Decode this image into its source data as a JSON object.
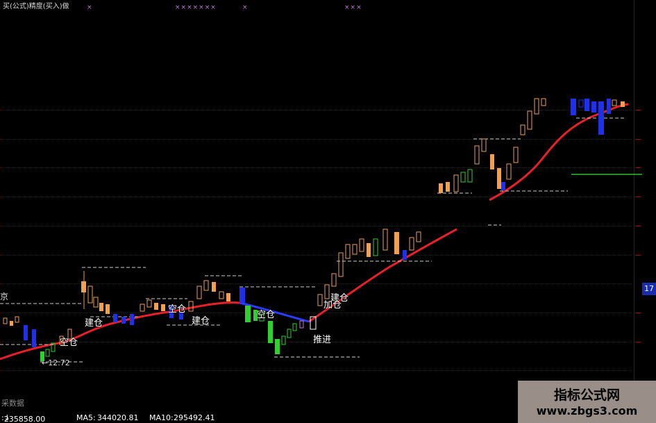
{
  "header": {
    "title": "买(公式)精度(买入)做",
    "x_marks": [
      "×",
      "×××××××",
      "×",
      "×××"
    ]
  },
  "annotations": [
    {
      "id": "jiancang-1",
      "text": "建仓"
    },
    {
      "id": "kongcang-1",
      "text": "空仓"
    },
    {
      "id": "kongcang-2",
      "text": "空仓"
    },
    {
      "id": "jiancang-2",
      "text": "建仓"
    },
    {
      "id": "kongcang-3",
      "text": "空仓"
    },
    {
      "id": "jiancang-3",
      "text": "建仓"
    },
    {
      "id": "jiacang",
      "text": "加仓"
    },
    {
      "id": "tuijin",
      "text": "推进"
    }
  ],
  "price_label": "12.72",
  "left_edge_label": "京",
  "current_price_badge": "17",
  "source_label": "采数据",
  "status_bar": {
    "volume": "235858.00",
    "ma5_label": "MA5:",
    "ma5_value": "344020.81",
    "ma10_label": "MA10:",
    "ma10_value": "295492.41"
  },
  "watermark": {
    "title": "指标公式网",
    "url": "www.zbgs3.com"
  },
  "colors": {
    "background": "#000000",
    "ma_line": "#e8202a",
    "ma_line_blue": "#2a3cff",
    "candle_up": "#f0a050",
    "candle_down_blue": "#2030e8",
    "candle_green": "#30d030",
    "dashed_line": "#cccccc",
    "grid": "#6a0000",
    "axis": "#7a0000",
    "watermark_bg": "#9a8f88"
  }
}
